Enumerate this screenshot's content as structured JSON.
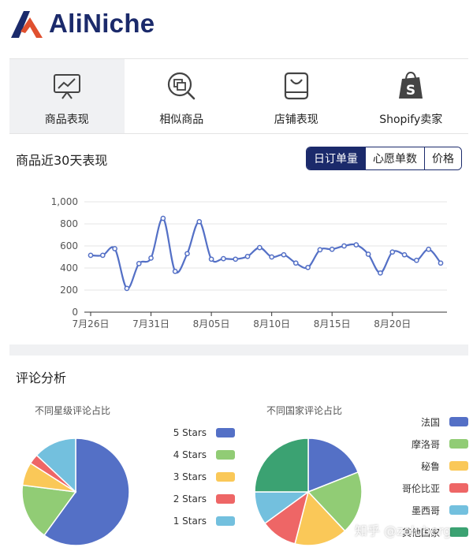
{
  "brand": {
    "name": "AliNiche"
  },
  "tabs": [
    {
      "label": "商品表现",
      "icon": "chart-board-icon",
      "active": true
    },
    {
      "label": "相似商品",
      "icon": "search-product-icon",
      "active": false
    },
    {
      "label": "店铺表现",
      "icon": "shop-icon",
      "active": false
    },
    {
      "label": "Shopify卖家",
      "icon": "shopify-bag-icon",
      "active": false
    }
  ],
  "performance": {
    "title": "商品近30天表现",
    "toggles": [
      {
        "label": "日订单量",
        "active": true
      },
      {
        "label": "心愿单数",
        "active": false
      },
      {
        "label": "价格",
        "active": false
      }
    ]
  },
  "reviews": {
    "title": "评论分析"
  },
  "watermark": "知乎 @zoluberg",
  "colors": {
    "brand": "#1b2a6b",
    "accent": "#e0502f",
    "line": "#5470c6"
  },
  "chart_data": [
    {
      "type": "line",
      "title": "",
      "xlabel": "",
      "ylabel": "",
      "yticks": [
        "0",
        "200",
        "400",
        "600",
        "800",
        "1,000"
      ],
      "ylim": [
        0,
        1000
      ],
      "xticks": [
        "7月26日",
        "7月31日",
        "8月05日",
        "8月10日",
        "8月15日",
        "8月20日"
      ],
      "xtick_index": [
        0,
        5,
        10,
        15,
        20,
        25
      ],
      "grid": true,
      "x": [
        "7月26日",
        "7月27日",
        "7月28日",
        "7月29日",
        "7月30日",
        "7月31日",
        "8月01日",
        "8月02日",
        "8月03日",
        "8月04日",
        "8月05日",
        "8月06日",
        "8月07日",
        "8月08日",
        "8月09日",
        "8月10日",
        "8月11日",
        "8月12日",
        "8月13日",
        "8月14日",
        "8月15日",
        "8月16日",
        "8月17日",
        "8月18日",
        "8月19日",
        "8月20日",
        "8月21日",
        "8月22日",
        "8月23日",
        "8月24日"
      ],
      "series": [
        {
          "values": [
            515,
            515,
            575,
            215,
            440,
            490,
            850,
            370,
            530,
            820,
            480,
            485,
            480,
            505,
            585,
            500,
            520,
            445,
            405,
            565,
            570,
            600,
            610,
            525,
            355,
            545,
            520,
            470,
            570,
            445
          ]
        }
      ]
    },
    {
      "type": "pie",
      "title": "不同星级评论占比",
      "legend_position": "right",
      "labels": [
        "5 Stars",
        "4 Stars",
        "3 Stars",
        "2 Stars",
        "1 Stars"
      ],
      "values": [
        60,
        17,
        7,
        3,
        13
      ],
      "colors": [
        "#5470c6",
        "#91cc75",
        "#fac858",
        "#ee6666",
        "#73c0de"
      ]
    },
    {
      "type": "pie",
      "title": "不同国家评论占比",
      "legend_position": "right",
      "labels": [
        "法国",
        "摩洛哥",
        "秘鲁",
        "哥伦比亚",
        "墨西哥",
        "其他国家"
      ],
      "values": [
        19,
        19,
        16,
        11,
        10,
        25
      ],
      "colors": [
        "#5470c6",
        "#91cc75",
        "#fac858",
        "#ee6666",
        "#73c0de",
        "#3ba272"
      ]
    }
  ]
}
